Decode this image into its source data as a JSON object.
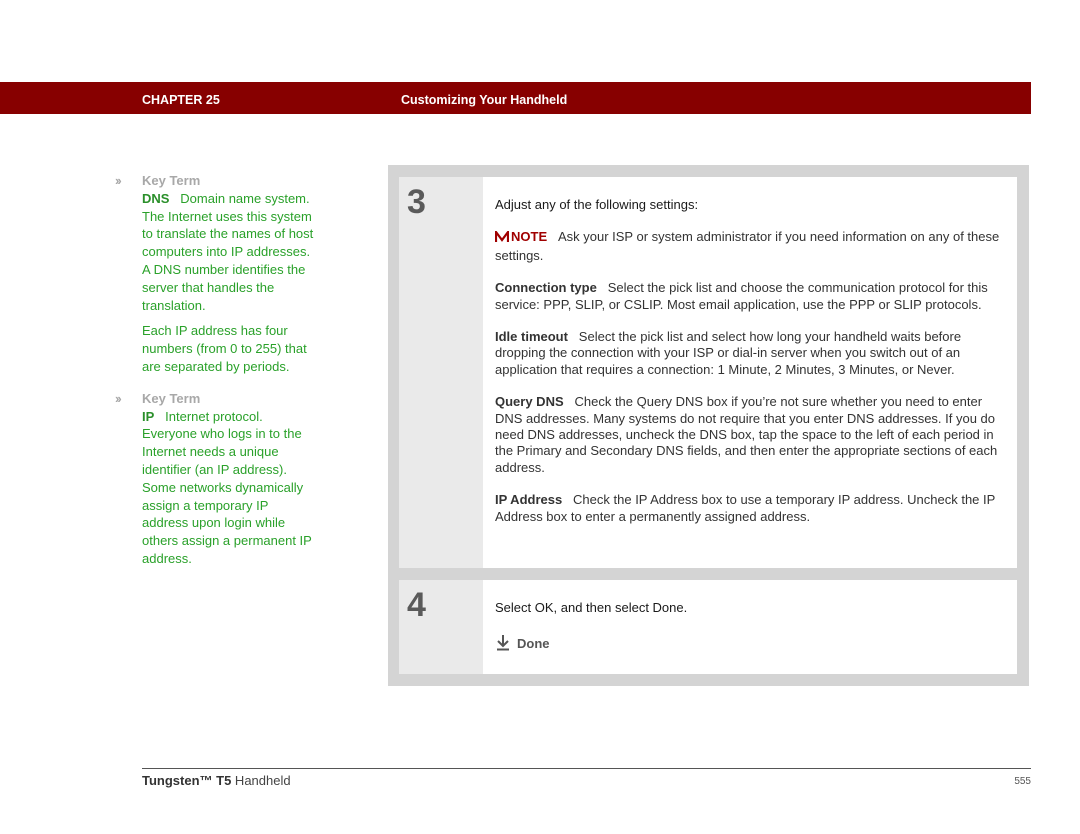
{
  "header": {
    "chapter": "CHAPTER 25",
    "title": "Customizing Your Handheld",
    "bar_color": "#870000"
  },
  "sidebar": {
    "key_terms": [
      {
        "heading": "Key Term",
        "term": "DNS",
        "paragraphs": [
          "Domain name system. The Internet uses this system to translate the names of host computers into IP addresses. A DNS number identifies the server that handles the translation.",
          "Each IP address has four numbers (from 0 to 255) that are separated by periods."
        ]
      },
      {
        "heading": "Key Term",
        "term": "IP",
        "paragraphs": [
          "Internet protocol. Everyone who logs in to the Internet needs a unique identifier (an IP address). Some networks dynamically assign a temporary IP address upon login while others assign a permanent IP address."
        ]
      }
    ]
  },
  "steps": [
    {
      "number": "3",
      "lead": "Adjust any of the following settings:",
      "note": {
        "label": "NOTE",
        "text": "Ask your ISP or system administrator if you need information on any of these settings."
      },
      "settings": [
        {
          "name": "Connection type",
          "text": "Select the pick list and choose the communication protocol for this service: PPP, SLIP, or CSLIP. Most email application, use the PPP or SLIP protocols."
        },
        {
          "name": "Idle timeout",
          "text": "Select the pick list and select how long your handheld waits before dropping the connection with your ISP or dial-in server when you switch out of an application that requires a connection: 1 Minute, 2 Minutes, 3 Minutes, or Never."
        },
        {
          "name": "Query DNS",
          "text": "Check the Query DNS box if you’re not sure whether you need to enter DNS addresses. Many systems do not require that you enter DNS addresses. If you do need DNS addresses, uncheck the DNS box, tap the space to the left of each period in the Primary and Secondary DNS fields, and then enter the appropriate sections of each address."
        },
        {
          "name": "IP Address",
          "text": "Check the IP Address box to use a temporary IP address. Uncheck the IP Address box to enter a permanently assigned address."
        }
      ]
    },
    {
      "number": "4",
      "lead": "Select OK, and then select Done.",
      "done_label": "Done"
    }
  ],
  "footer": {
    "product_bold": "Tungsten™ T5",
    "product_rest": " Handheld",
    "page_number": "555"
  }
}
